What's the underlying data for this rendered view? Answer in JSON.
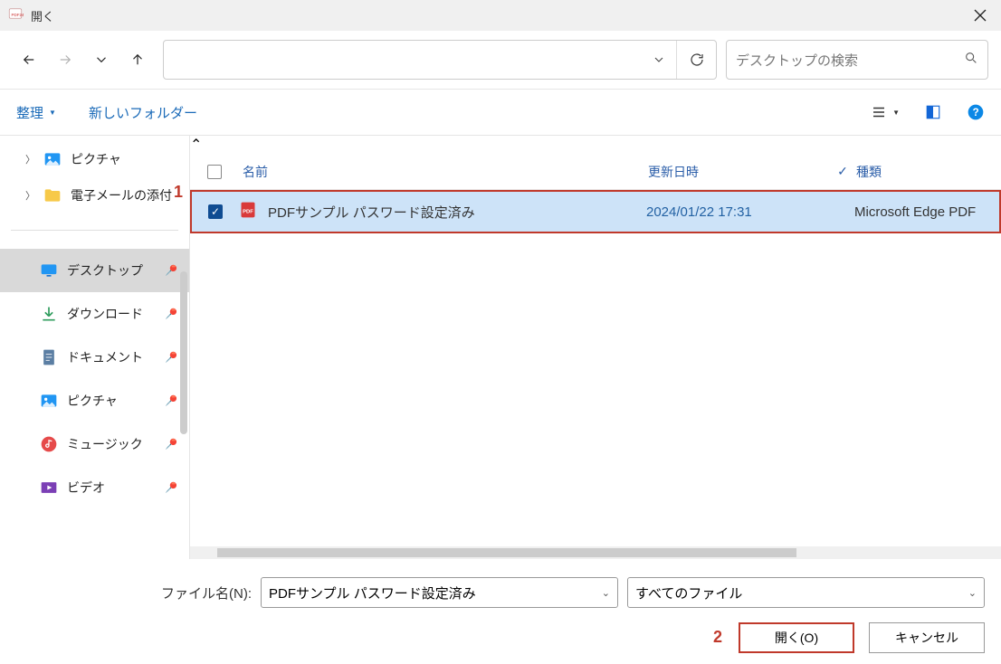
{
  "window": {
    "title": "開く"
  },
  "search": {
    "placeholder": "デスクトップの検索"
  },
  "toolbar": {
    "organize": "整理",
    "new_folder": "新しいフォルダー"
  },
  "tree": {
    "pictures": "ピクチャ",
    "email_attach": "電子メールの添付"
  },
  "quick": {
    "desktop": "デスクトップ",
    "downloads": "ダウンロード",
    "documents": "ドキュメント",
    "pictures": "ピクチャ",
    "music": "ミュージック",
    "videos": "ビデオ"
  },
  "columns": {
    "name": "名前",
    "date": "更新日時",
    "type": "種類"
  },
  "file": {
    "name": "PDFサンプル パスワード設定済み",
    "date": "2024/01/22 17:31",
    "type": "Microsoft Edge PDF"
  },
  "bottom": {
    "filename_label": "ファイル名(N):",
    "filename_value": "PDFサンプル パスワード設定済み",
    "filter": "すべてのファイル",
    "open": "開く(O)",
    "cancel": "キャンセル"
  },
  "annotations": {
    "one": "1",
    "two": "2"
  }
}
